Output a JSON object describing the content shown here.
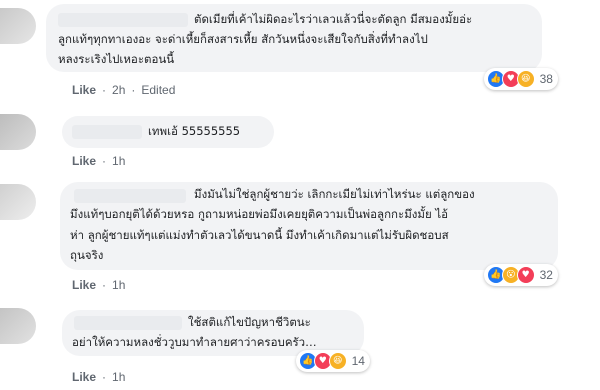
{
  "comments": [
    {
      "lines": [
        "ตัดเมียที่เค้าไม่ผิดอะไรว่าเลวแล้วนี่จะตัดลูก มีสมองมั้ยอ่ะ",
        "ลูกแท้ๆทุกทาเองอะ จะด่าเหี้ยก็สงสารเหี้ย สักวันหนึ่งจะเสียใจกับสิ่งที่ทำลงไป",
        "หลงระเริงไปเหอะตอนนี้"
      ],
      "like_label": "Like",
      "time": "2h",
      "edited": "Edited",
      "reactions": [
        "like-icon",
        "love-icon",
        "haha-icon"
      ],
      "reaction_count": "38"
    },
    {
      "lines": [
        "เทพเอ้ 55555555"
      ],
      "like_label": "Like",
      "time": "1h"
    },
    {
      "lines": [
        "มึงมันไม่ใช่ลูกผู้ชายว่ะ เลิกกะเมียไม่เท่าไหร่นะ แต่ลูกของ",
        "มึงแท้ๆบอกยุติได้ด้วยหรอ กูถามหน่อยพ่อมึงเคยยุติความเป็นพ่อลูกกะมึงมั้ย ไอ้",
        "ห่า ลูกผู้ชายแท้ๆแต่แม่งทำตัวเลวได้ขนาดนี้ มึงทำเค้าเกิดมาแต่ไม่รับผิดชอบส",
        "ถุนจริง"
      ],
      "like_label": "Like",
      "time": "1h",
      "reactions": [
        "like-icon",
        "wow-icon",
        "love-icon"
      ],
      "reaction_count": "32"
    },
    {
      "lines": [
        "ใช้สติแก้ไขปัญหาชีวิตนะ",
        "อย่าให้ความหลงชั่ววูบมาทำลายศาว่าครอบครัว…"
      ],
      "like_label": "Like",
      "time": "1h",
      "reactions": [
        "like-icon",
        "love-icon",
        "haha-icon"
      ],
      "reaction_count": "14"
    }
  ],
  "reaction_glyphs": {
    "like-icon": "👍",
    "love-icon": "♥",
    "haha-icon": "😆",
    "wow-icon": "😮"
  },
  "colors": {
    "bubble": "#f2f3f5",
    "like": "#2078f4",
    "love": "#f33e58",
    "haha": "#f7b125",
    "meta": "#606770",
    "text": "#1c1e21"
  }
}
